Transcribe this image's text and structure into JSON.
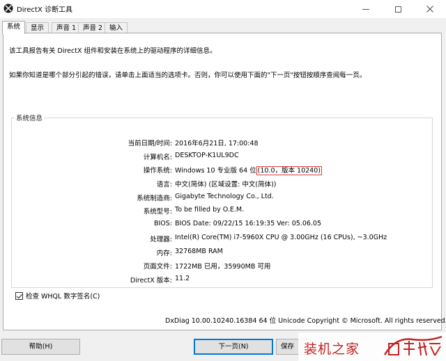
{
  "window": {
    "title": "DirectX 诊断工具"
  },
  "tabs": [
    {
      "label": "系统",
      "active": true
    },
    {
      "label": "显示",
      "active": false
    },
    {
      "label": "声音 1",
      "active": false
    },
    {
      "label": "声音 2",
      "active": false
    },
    {
      "label": "输入",
      "active": false
    }
  ],
  "intro": {
    "line1": "该工具报告有关 DirectX 组件和安装在系统上的驱动程序的详细信息。",
    "line2": "如果你知道是哪个部分引起的错误，请单击上面适当的选项卡。否则，你可以使用下面的\"下一页\"按钮按顺序查阅每一页。"
  },
  "system_info": {
    "group_title": "系统信息",
    "rows": [
      {
        "label": "当前日期/时间:",
        "value": "2016年6月21日, 17:00:48"
      },
      {
        "label": "计算机名:",
        "value": "DESKTOP-K1UL9DC"
      },
      {
        "label": "操作系统:",
        "value": "Windows 10 专业版 64 位",
        "value_highlight": "(10.0，版本 10240)"
      },
      {
        "label": "语言:",
        "value": "中文(简体) (区域设置: 中文(简体))"
      },
      {
        "label": "系统制造商:",
        "value": "Gigabyte Technology Co., Ltd."
      },
      {
        "label": "系统型号:",
        "value": "To be filled by O.E.M."
      },
      {
        "label": "BIOS:",
        "value": "BIOS Date: 09/22/15 16:19:35 Ver: 05.06.05"
      },
      {
        "label": "处理器:",
        "value": "Intel(R) Core(TM) i7-5960X CPU @ 3.00GHz (16 CPUs), ~3.0GHz"
      },
      {
        "label": "内存:",
        "value": "32768MB RAM"
      },
      {
        "label": "页面文件:",
        "value": "1722MB 已用，35990MB 可用"
      },
      {
        "label": "DirectX 版本:",
        "value": "11.2"
      }
    ]
  },
  "whql": {
    "label": "检查 WHQL 数字签名(C)",
    "checked": true
  },
  "footer": {
    "copyright": "DxDiag 10.00.10240.16384 64 位 Unicode  Copyright © Microsoft. All rights reserved."
  },
  "buttons": {
    "help": "帮助(H)",
    "next": "下一页(N)",
    "save": "保存"
  },
  "watermark": {
    "text": "装机之家"
  },
  "colors": {
    "highlight_border": "#d63b3b",
    "default_button_border": "#0078d7",
    "watermark": "#c42121"
  }
}
